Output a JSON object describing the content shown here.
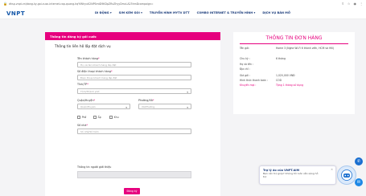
{
  "browser": {
    "url": "dhsp.vnpt.vn/dang-ky-goi-cuoc-internet-cap-quang-hqYiWhyuK2NPSmtD9KDpZRxZhyyDmcLA23hmDcampaign=",
    "icons": [
      "share-icon",
      "star-icon",
      "profile-icon",
      "menu-icon"
    ]
  },
  "header": {
    "logo": "VNPT",
    "nav": [
      "DI ĐỘNG ▾",
      "SIM KÈM GÓI ▾",
      "TRUYỀN HÌNH MYTV DTT",
      "COMBO INTERNET & TRUYỀN HÌNH ▾",
      "DỊCH VỤ BÁN MỞ"
    ]
  },
  "form": {
    "header": "Thông tin đăng ký gói cước",
    "section_title": "Thông tin liên hệ lắp đặt dịch vụ",
    "name_label": "Tên khách hàng",
    "name_placeholder": "Họ và tên khách hàng lắp đặt",
    "phone_label": "Số điện thoại khách hàng",
    "phone_placeholder": "Điện thoại khách hàng lắp đặt",
    "province_label": "Tỉnh/TP",
    "province_value": "Tỉnh/Thành phố",
    "district_label": "Quận/Huyện",
    "district_value": "Quận/Huyện",
    "ward_label": "Phường/Xã",
    "ward_value": "Xã/Phường",
    "checks": [
      "Phố",
      "Ấp",
      "Khu"
    ],
    "address_label": "Số nhà",
    "address_placeholder": "Số nhà/Số hẻm",
    "referrer_label": "Thông tin người giới thiệu",
    "submit": "Đăng ký",
    "required_mark": "*"
  },
  "order": {
    "title": "THÔNG TIN ĐƠN HÀNG",
    "rows": [
      {
        "key": "Tên gói:",
        "value": "Home 3 (Nghe Wi-Fi 6 thành viên, HCM và HN)"
      },
      {
        "key": "Chu kỳ :",
        "value": "6 tháng"
      },
      {
        "key": "Họ và tên :",
        "value": ""
      },
      {
        "key": "Địa chỉ :",
        "value": ""
      },
      {
        "key": "Giá gói :",
        "value": "1,020,000 VNĐ"
      },
      {
        "key": "Hình thức thanh toán :",
        "value": "COD"
      },
      {
        "key": "Khuyến mại :",
        "value": "Tặng 1 tháng sử dụng"
      }
    ]
  },
  "chat": {
    "title": "Trợ lý ảo của VNPT.AIM",
    "subtitle": "Bạn cần trợ giúp? Chúng tôi luôn sẵn sàng hỗ trợ",
    "close": "✕"
  },
  "colors": {
    "accent": "#e6007e",
    "brand": "#1256a8"
  }
}
